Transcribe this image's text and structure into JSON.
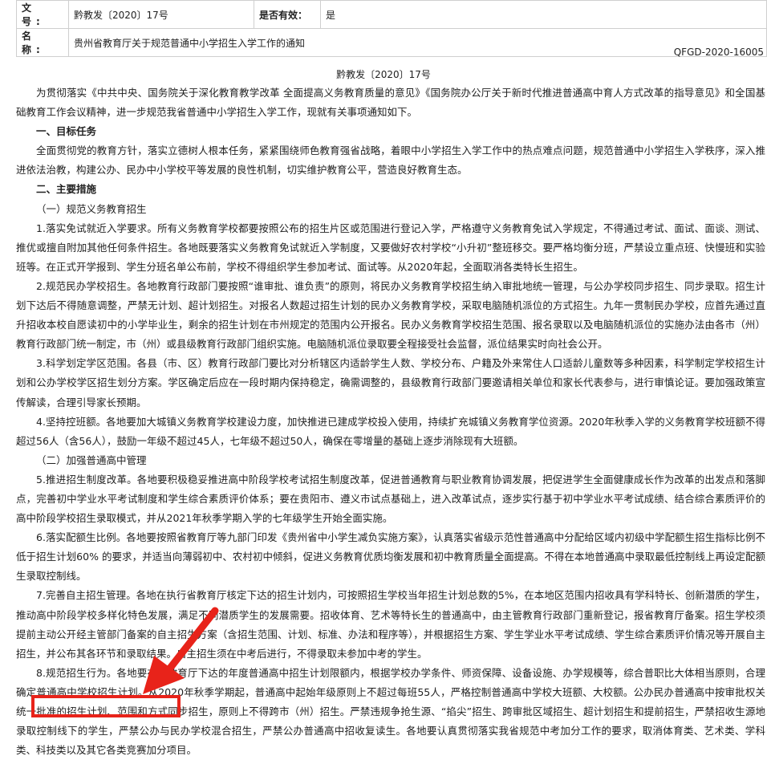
{
  "meta": {
    "doc_number_label": "文 号:",
    "doc_number_value": "黔教发〔2020〕17号",
    "validity_label": "是否有效：",
    "validity_value": "是",
    "name_label": "名 称:",
    "name_value": "贵州省教育厅关于规范普通中小学招生入学工作的通知"
  },
  "doc": {
    "code": "QFGD-2020-16005",
    "number": "黔教发〔2020〕17号"
  },
  "paragraphs": [
    "为贯彻落实《中共中央、国务院关于深化教育教学改革 全面提高义务教育质量的意见》《国务院办公厅关于新时代推进普通高中育人方式改革的指导意见》和全国基础教育工作会议精神，进一步规范我省普通中小学招生入学工作，现就有关事项通知如下。",
    "一、目标任务",
    "全面贯彻党的教育方针，落实立德树人根本任务，紧紧围绕师色教育强省战略，着眼中小学招生入学工作中的热点难点问题，规范普通中小学招生入学秩序，深入推进依法治教，构建公办、民办中小学校平等发展的良性机制，切实维护教育公平，营造良好教育生态。",
    "二、主要措施",
    "（一）规范义务教育招生",
    "1.落实免试就近入学要求。所有义务教育学校都要按照公布的招生片区或范围进行登记入学，严格遵守义务教育免试入学规定，不得通过考试、面试、面谈、测试、推优或擅自附加其他任何条件招生。各地既要落实义务教育免试就近入学制度，又要做好农村学校“小升初”整班移交。要严格均衡分班，严禁设立重点班、快慢班和实验班等。在正式开学报到、学生分班名单公布前，学校不得组织学生参加考试、面试等。从2020年起，全面取消各类特长生招生。",
    "2.规范民办学校招生。各地教育行政部门要按照“谁审批、谁负责”的原则，将民办义务教育学校招生纳入审批地统一管理，与公办学校同步招生、同步录取。招生计划下达后不得随意调整，严禁无计划、超计划招生。对报名人数超过招生计划的民办义务教育学校，采取电脑随机派位的方式招生。九年一贯制民办学校，应首先通过直升招收本校自愿读初中的小学毕业生，剩余的招生计划在市州规定的范围内公开报名。民办义务教育学校招生范围、报名录取以及电脑随机派位的实施办法由各市（州）教育行政部门统一制定，市（州）或县级教育行政部门组织实施。电脑随机派位录取要全程接受社会监督，派位结果实时向社会公开。",
    "3.科学划定学区范围。各县（市、区）教育行政部门要比对分析辖区内适龄学生人数、学校分布、户籍及外来常住人口适龄儿童数等多种因素，科学制定学校招生计划和公办学校学区招生划分方案。学区确定后应在一段时期内保持稳定，确需调整的，县级教育行政部门要邀请相关单位和家长代表参与，进行审慎论证。要加强政策宣传解读，合理引导家长预期。",
    "4.坚持控班额。各地要加大城镇义务教育学校建设力度，加快推进已建成学校投入使用，持续扩充城镇义务教育学位资源。2020年秋季入学的义务教育学校班额不得超过56人（含56人），鼓励一年级不超过45人，七年级不超过50人，确保在零增量的基础上逐步消除现有大班额。",
    "（二）加强普通高中管理",
    "5.推进招生制度改革。各地要积极稳妥推进高中阶段学校考试招生制度改革，促进普通教育与职业教育协调发展，把促进学生全面健康成长作为改革的出发点和落脚点，完善初中学业水平考试制度和学生综合素质评价体系；要在贵阳市、遵义市试点基础上，进入改革试点，逐步实行基于初中学业水平考试成绩、结合综合素质评价的高中阶段学校招生录取模式，并从2021年秋季学期入学的七年级学生开始全面实施。",
    "6.落实配额生比例。各地要按照省教育厅等九部门印发《贵州省中小学生减负实施方案》，认真落实省级示范性普通高中分配给区域内初级中学配额生招生指标比例不低于招生计划60% 的要求，并适当向薄弱初中、农村初中倾斜，促进义务教育优质均衡发展和初中教育质量全面提高。不得在本地普通高中录取最低控制线上再设定配额生录取控制线。",
    "7.完善自主招生管理。各地在执行省教育厅核定下达的招生计划内，可按照招生学校当年招生计划总数的5%，在本地区范围内招收具有学科特长、创新潜质的学生，推动高中阶段学校多样化特色发展，满足不同潜质学生的发展需要。招收体育、艺术等特长生的普通高中，由主管教育行政部门重新登记，报省教育厅备案。招生学校须提前主动公开经主管部门备案的自主招生方案（含招生范围、计划、标准、办法和程序等），并根据招生方案、学生学业水平考试成绩、学生综合素质评价情况等开展自主招生，并公布其各环节和录取结果。自主招生须在中考后进行，不得录取未参加中考的学生。",
    "8.规范招生行为。各地要在省教育厅下达的年度普通高中招生计划限额内，根据学校办学条件、师资保障、设备设施、办学规模等，综合普职比大体相当原则，合理确定普通高中学校招生计划。从2020年秋季学期起，普通高中起始年级原则上不超过每班55人，严格控制普通高中学校大班额、大校额。公办民办普通高中按审批权关统一批准的招生计划、范围和方式同步招生，原则上不得跨市（州）招生。严禁违规争抢生源、“掐尖”招生、跨审批区域招生、超计划招生和提前招生，严禁招收生源地录取控制线下的学生，严禁公办与民办学校混合招生，严禁公办普通高中招收复读生。各地要认真贯彻落实我省规范中考加分工作的要求，取消体育类、艺术类、学科类、科技类以及其它各类竞赛加分项目。"
  ]
}
